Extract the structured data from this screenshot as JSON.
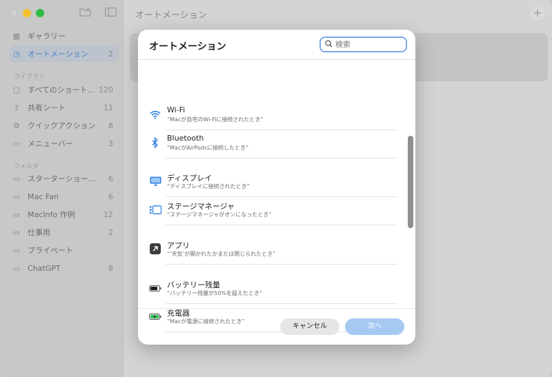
{
  "window": {
    "title": "オートメーション",
    "plus_label": "+"
  },
  "sidebar": {
    "top_items": [
      {
        "label": "ギャラリー",
        "count": ""
      },
      {
        "label": "オートメーション",
        "count": "2"
      }
    ],
    "library_header": "ライブラリ",
    "library_items": [
      {
        "label": "すべてのショート…",
        "count": "120"
      },
      {
        "label": "共有シート",
        "count": "11"
      },
      {
        "label": "クイックアクション",
        "count": "8"
      },
      {
        "label": "メニューバー",
        "count": "3"
      }
    ],
    "folder_header": "フォルダ",
    "folder_items": [
      {
        "label": "スターターショートカ…",
        "count": "6"
      },
      {
        "label": "Mac Fan",
        "count": "6"
      },
      {
        "label": "MacInfo 作例",
        "count": "12"
      },
      {
        "label": "仕事用",
        "count": "2"
      },
      {
        "label": "プライベート",
        "count": ""
      },
      {
        "label": "ChatGPT",
        "count": "8"
      }
    ]
  },
  "modal": {
    "title": "オートメーション",
    "search_placeholder": "検索",
    "rows": [
      {
        "icon": "wifi-icon",
        "title": "Wi-Fi",
        "subtitle": "“Macが自宅のWi-Fiに接続されたとき”"
      },
      {
        "icon": "bluetooth-icon",
        "title": "Bluetooth",
        "subtitle": "“MacがAirPodsに接続したとき”"
      },
      {
        "icon": "display-icon",
        "title": "ディスプレイ",
        "subtitle": "“ディスプレイに接続されたとき”"
      },
      {
        "icon": "stage-manager-icon",
        "title": "ステージマネージャ",
        "subtitle": "“ステージマネージャがオンになったとき”"
      },
      {
        "icon": "app-icon",
        "title": "アプリ",
        "subtitle": "“‘天気’が開かれたかまたは閉じられたとき”"
      },
      {
        "icon": "battery-icon",
        "title": "バッテリー残量",
        "subtitle": "“バッテリー残量が50%を超えたとき”"
      },
      {
        "icon": "charger-icon",
        "title": "充電器",
        "subtitle": "“Macが電源に接続されたとき”"
      }
    ],
    "cancel_label": "キャンセル",
    "next_label": "次へ"
  },
  "colors": {
    "accent": "#4a83d1",
    "next_button": "#a6c9f2"
  }
}
